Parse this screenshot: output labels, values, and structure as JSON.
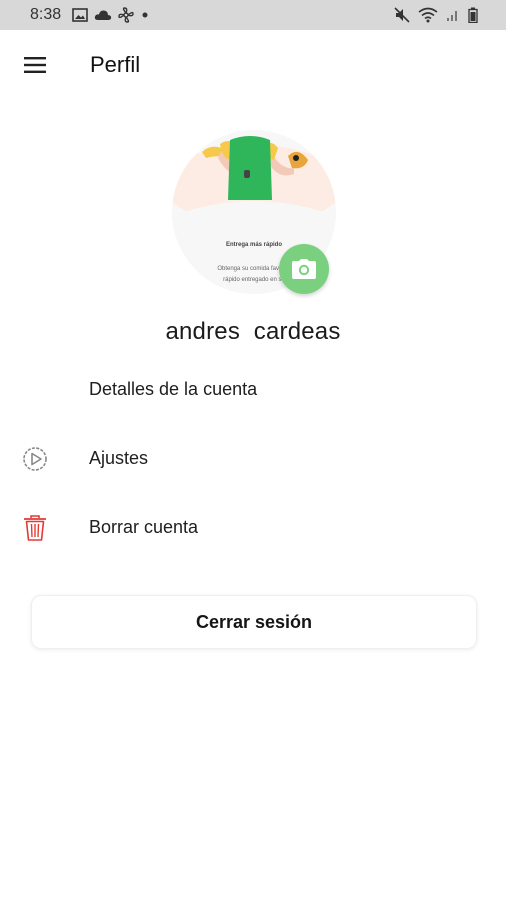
{
  "status_bar": {
    "time": "8:38",
    "left_icons": [
      "image-icon",
      "cloud-icon",
      "fan-icon",
      "dot-icon"
    ],
    "right_icons": [
      "mute-icon",
      "wifi-icon",
      "signal-icon",
      "battery-icon"
    ]
  },
  "app_bar": {
    "title": "Perfil",
    "menu_icon": "hamburger-menu-icon"
  },
  "profile": {
    "avatar_caption_title": "Entrega más rápido",
    "avatar_caption_line1": "Obtenga su comida favorita",
    "avatar_caption_line2": "rápido entregado en su",
    "camera_icon": "camera-icon",
    "name": "andres  cardeas",
    "colors": {
      "camera_button": "#7bd080",
      "shirt": "#2fb55a",
      "delete_icon": "#e53935"
    }
  },
  "menu": {
    "items": [
      {
        "label": "Detalles de la cuenta",
        "icon": ""
      },
      {
        "label": "Ajustes",
        "icon": "settings-play-icon"
      },
      {
        "label": "Borrar cuenta",
        "icon": "trash-icon"
      }
    ]
  },
  "logout": {
    "label": "Cerrar sesión"
  }
}
